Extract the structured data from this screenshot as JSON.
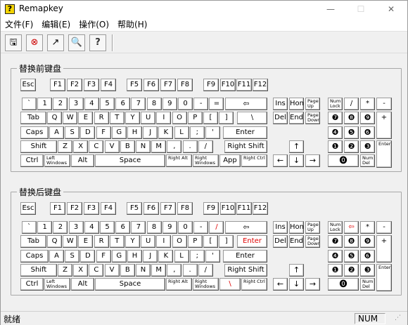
{
  "window": {
    "title": "Remapkey",
    "minimize": "—",
    "maximize": "☐",
    "close": "✕"
  },
  "menu": [
    "文件(F)",
    "编辑(E)",
    "操作(O)",
    "帮助(H)"
  ],
  "toolbar": [
    "🖫",
    "⊗",
    "↗",
    "🔍",
    "?"
  ],
  "groups": {
    "before": "替换前键盘",
    "after": "替换后键盘"
  },
  "status": {
    "left": "就绪",
    "num": "NUM"
  }
}
